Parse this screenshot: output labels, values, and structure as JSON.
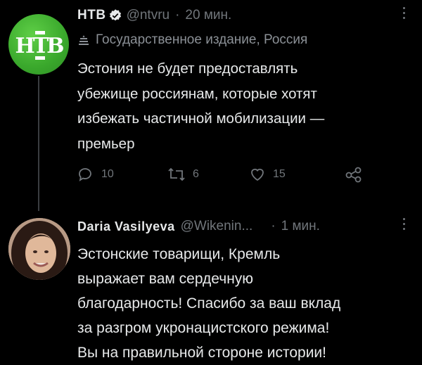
{
  "tweets": [
    {
      "author": {
        "name": "НТВ",
        "handle": "@ntvru"
      },
      "separator": "·",
      "time": "20 мин.",
      "label": "Государственное издание, Россия",
      "body_lines": [
        "Эстония не будет предоставлять",
        "убежище россиянам, которые хотят",
        "избежать частичной мобилизации —",
        "премьер"
      ],
      "actions": {
        "replies": "10",
        "retweets": "6",
        "likes": "15"
      },
      "logo_text": "НТВ"
    },
    {
      "author": {
        "name": "Daria Vasilyeva",
        "handle": "@Wikenin..."
      },
      "separator": "·",
      "time": "1 мин.",
      "body_lines": [
        "Эстонские товарищи, Кремль",
        "выражает вам сердечную",
        "благодарность! Спасибо за ваш вклад",
        "за разгром укронацистского режима!",
        "Вы на правильной стороне истории!"
      ]
    }
  ],
  "colors": {
    "background": "#000000",
    "text": "#e7e9ea",
    "muted": "#71767b",
    "ntv_green": "#3aa82c"
  },
  "icons": [
    "verified-icon",
    "government-icon",
    "reply-icon",
    "retweet-icon",
    "like-icon",
    "share-icon",
    "more-icon"
  ]
}
